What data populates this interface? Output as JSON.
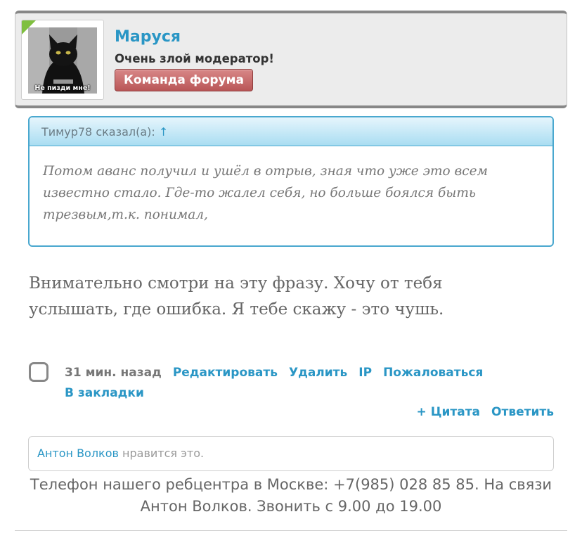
{
  "author": {
    "name": "Маруся",
    "title": "Очень злой модератор!",
    "group": "Команда форума",
    "avatar_caption": "Не пизди мне!"
  },
  "quote": {
    "author": "Тимур78 сказал(а):",
    "arrow": "↑",
    "text": "Потом аванс получил и ушёл в отрыв, зная что уже это всем известно стало. Где-то жалел себя, но больше боялся быть трезвым,т.к. понимал,"
  },
  "message": "Внимательно смотри на эту фразу. Хочу от тебя услышать, где ошибка. Я тебе скажу - это чушь.",
  "post_meta": {
    "time": "31 мин. назад",
    "edit": "Редактировать",
    "delete": "Удалить",
    "ip": "IP",
    "report": "Пожаловаться",
    "bookmark": "В закладки"
  },
  "actions": {
    "quote": "+ Цитата",
    "reply": "Ответить"
  },
  "likes": {
    "user": "Антон Волков",
    "text": " нравится это."
  },
  "signature": "Телефон нашего ребцентра в Москве: +7(985) 028 85 85. На связи Антон Волков. Звонить с 9.00 до 19.00",
  "colors": {
    "link": "#2a96c5",
    "badge": "#b95657",
    "quote_border": "#4aa8cf"
  }
}
